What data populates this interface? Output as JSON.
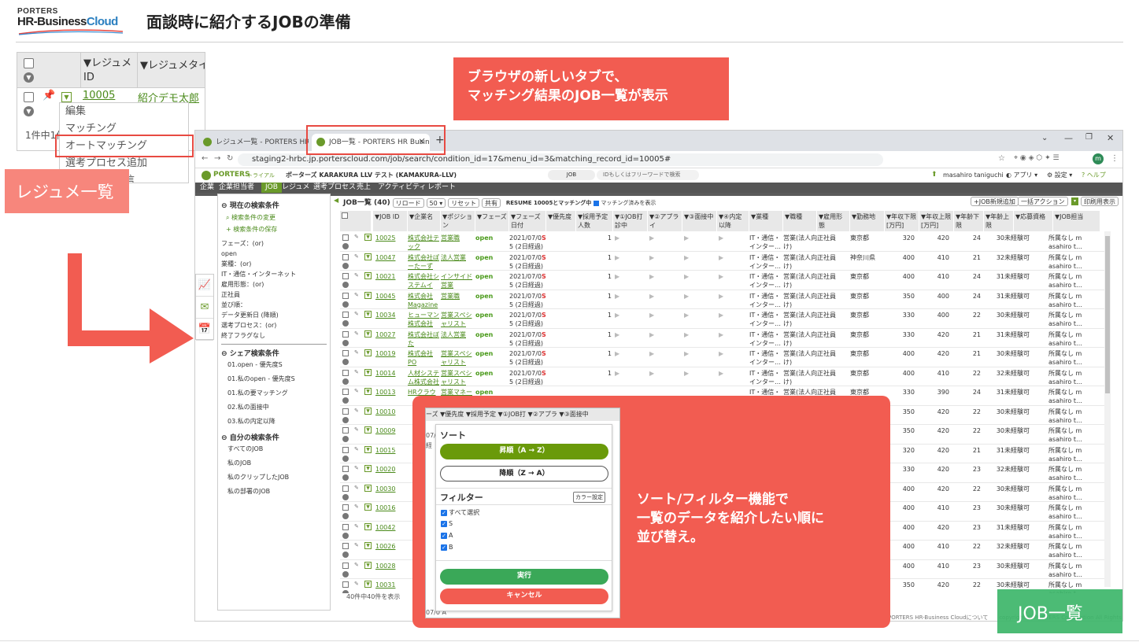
{
  "logo": {
    "line1": "PORTERS",
    "line2a": "HR-Business",
    "line2b": "Cloud"
  },
  "page_title": "面談時に紹介するJOBの準備",
  "callouts": {
    "top": [
      "ブラウザの新しいタブで、",
      "マッチング結果のJOB一覧が表示"
    ],
    "bottom": [
      "ソート/フィルター機能で",
      "一覧のデータを紹介したい順に",
      "並び替え。"
    ]
  },
  "tags": {
    "resume": "レジュメ一覧",
    "job": "JOB一覧"
  },
  "resume_table": {
    "col1": "▼レジュメ ID",
    "col2": "▼レジュメタイ",
    "id": "10005",
    "name": "紹介デモ太郎",
    "count": "1件中1件",
    "menu": [
      "編集",
      "マッチング",
      "オートマッチング",
      "選考プロセス追加",
      "JOBメール送信"
    ]
  },
  "browser": {
    "tabs": [
      {
        "label": "レジュメ一覧 - PORTERS HR Business"
      },
      {
        "label": "JOB一覧 - PORTERS HR Business"
      }
    ],
    "url": "staging2-hrbc.jp.porterscloud.com/job/search/condition_id=17&menu_id=3&matching_record_id=10005#",
    "app": {
      "logo": "PORTERS",
      "trial": "トライアル",
      "company": "ポーターズ KARAKURA LLV テスト (KAMAKURA-LLV)",
      "search_scope": "JOB",
      "search_placeholder": "IDもしくはフリーワードで検索",
      "user": "masahiro taniguchi",
      "app_menu": "アプリ",
      "settings": "設定",
      "help": "ヘルプ"
    },
    "nav": [
      "企業",
      "企業担当者",
      "JOB",
      "レジュメ",
      "選考プロセス",
      "売上",
      "アクティビティ",
      "レポート"
    ],
    "left": {
      "current": "現在の検索条件",
      "change": "検索条件の変更",
      "save": "検索条件の保存",
      "conditions": [
        "フェーズ：(or)",
        "open",
        "業種：(or)",
        "IT・通信・インターネット",
        "雇用形態：(or)",
        "正社員",
        "並び順：",
        "データ更新日 (降順)",
        "選考プロセス：(or)",
        "終了フラグなし"
      ],
      "shared": "シェア検索条件",
      "shared_items": [
        "01.open - 優先度S",
        "01.私のopen - 優先度S",
        "01.私の要マッチング",
        "02.私の面接中",
        "03.私の内定以降"
      ],
      "mine": "自分の検索条件",
      "mine_items": [
        "すべてのJOB",
        "私のJOB",
        "私のクリップしたJOB",
        "私の部署のJOB"
      ]
    },
    "list": {
      "title": "JOB一覧 (40)",
      "reload": "リロード",
      "per_page": "50",
      "reset": "リセット",
      "share": "共有",
      "matching": "RESUME 10005とマッチング中",
      "show_matched": "マッチング済みを表示",
      "new": "+JOB新規追加",
      "bulk": "一括アクション",
      "print": "印刷用表示",
      "footer": "40件中40件を表示"
    },
    "columns": [
      "▼JOB ID",
      "▼企業名",
      "▼ポジション",
      "▼フェーズ",
      "▼フェーズ日付",
      "▼優先度",
      "▼採用予定人数",
      "▼①JOB打診中",
      "▼②アプライ",
      "▼③面接中",
      "▼④内定以降",
      "▼業種",
      "▼職種",
      "▼雇用形態",
      "▼勤務地",
      "▼年収下限[万円]",
      "▼年収上限[万円]",
      "▼年齢下限",
      "▼年齢上限",
      "▼応募資格",
      "▼JOB担当"
    ],
    "rows": [
      {
        "id": "10025",
        "company": [
          "株式会社テ",
          "ック"
        ],
        "position": [
          "営業職",
          ""
        ],
        "phase": "open",
        "date": [
          "2021/07/0",
          "5 (2日経過)"
        ],
        "pri": "S",
        "hires": "1",
        "ind": [
          "IT・通信・",
          "インター…"
        ],
        "job": [
          "営業(法人向",
          "け)"
        ],
        "emp": "正社員",
        "loc": "東京都",
        "smin": "320",
        "smax": "420",
        "amin": "24",
        "amax": "30",
        "qual": "未経験可",
        "owner": [
          "所属なし m",
          "asahiro t…"
        ]
      },
      {
        "id": "10047",
        "company": [
          "株式会社ぽ",
          "ーたーず"
        ],
        "position": [
          "法人営業",
          ""
        ],
        "phase": "open",
        "date": [
          "2021/07/0",
          "5 (2日経過)"
        ],
        "pri": "S",
        "hires": "1",
        "ind": [
          "IT・通信・",
          "インター…"
        ],
        "job": [
          "営業(法人向",
          "け)"
        ],
        "emp": "正社員",
        "loc": "神奈川県",
        "smin": "400",
        "smax": "410",
        "amin": "21",
        "amax": "32",
        "qual": "未経験可",
        "owner": [
          "所属なし m",
          "asahiro t…"
        ]
      },
      {
        "id": "10021",
        "company": [
          "株式会社シ",
          "ステムイ"
        ],
        "position": [
          "インサイド",
          "営業"
        ],
        "phase": "open",
        "date": [
          "2021/07/0",
          "5 (2日経過)"
        ],
        "pri": "S",
        "hires": "1",
        "ind": [
          "IT・通信・",
          "インター…"
        ],
        "job": [
          "営業(法人向",
          "け)"
        ],
        "emp": "正社員",
        "loc": "東京都",
        "smin": "400",
        "smax": "410",
        "amin": "24",
        "amax": "31",
        "qual": "未経験可",
        "owner": [
          "所属なし m",
          "asahiro t…"
        ]
      },
      {
        "id": "10045",
        "company": [
          "株式会社",
          "Magazine"
        ],
        "position": [
          "営業職",
          ""
        ],
        "phase": "open",
        "date": [
          "2021/07/0",
          "5 (2日経過)"
        ],
        "pri": "S",
        "hires": "1",
        "ind": [
          "IT・通信・",
          "インター…"
        ],
        "job": [
          "営業(法人向",
          "け)"
        ],
        "emp": "正社員",
        "loc": "東京都",
        "smin": "350",
        "smax": "400",
        "amin": "24",
        "amax": "31",
        "qual": "未経験可",
        "owner": [
          "所属なし m",
          "asahiro t…"
        ]
      },
      {
        "id": "10034",
        "company": [
          "ヒューマン",
          "株式会社"
        ],
        "position": [
          "営業スペシ",
          "ャリスト"
        ],
        "phase": "open",
        "date": [
          "2021/07/0",
          "5 (2日経過)"
        ],
        "pri": "S",
        "hires": "1",
        "ind": [
          "IT・通信・",
          "インター…"
        ],
        "job": [
          "営業(法人向",
          "け)"
        ],
        "emp": "正社員",
        "loc": "東京都",
        "smin": "330",
        "smax": "400",
        "amin": "22",
        "amax": "30",
        "qual": "未経験可",
        "owner": [
          "所属なし m",
          "asahiro t…"
        ]
      },
      {
        "id": "10027",
        "company": [
          "株式会社ぼ",
          "た"
        ],
        "position": [
          "法人営業",
          ""
        ],
        "phase": "open",
        "date": [
          "2021/07/0",
          "5 (2日経過)"
        ],
        "pri": "S",
        "hires": "1",
        "ind": [
          "IT・通信・",
          "インター…"
        ],
        "job": [
          "営業(法人向",
          "け)"
        ],
        "emp": "正社員",
        "loc": "東京都",
        "smin": "330",
        "smax": "420",
        "amin": "21",
        "amax": "31",
        "qual": "未経験可",
        "owner": [
          "所属なし m",
          "asahiro t…"
        ]
      },
      {
        "id": "10019",
        "company": [
          "株式会社",
          "PO"
        ],
        "position": [
          "営業スペシ",
          "ャリスト"
        ],
        "phase": "open",
        "date": [
          "2021/07/0",
          "5 (2日経過)"
        ],
        "pri": "S",
        "hires": "1",
        "ind": [
          "IT・通信・",
          "インター…"
        ],
        "job": [
          "営業(法人向",
          "け)"
        ],
        "emp": "正社員",
        "loc": "東京都",
        "smin": "400",
        "smax": "420",
        "amin": "21",
        "amax": "30",
        "qual": "未経験可",
        "owner": [
          "所属なし m",
          "asahiro t…"
        ]
      },
      {
        "id": "10014",
        "company": [
          "人材システ",
          "ム株式会社"
        ],
        "position": [
          "営業スペシ",
          "ャリスト"
        ],
        "phase": "open",
        "date": [
          "2021/07/0",
          "5 (2日経過)"
        ],
        "pri": "S",
        "hires": "1",
        "ind": [
          "IT・通信・",
          "インター…"
        ],
        "job": [
          "営業(法人向",
          "け)"
        ],
        "emp": "正社員",
        "loc": "東京都",
        "smin": "400",
        "smax": "410",
        "amin": "22",
        "amax": "32",
        "qual": "未経験可",
        "owner": [
          "所属なし m",
          "asahiro t…"
        ]
      },
      {
        "id": "10013",
        "company": [
          "HRクラウ",
          ""
        ],
        "position": [
          "営業マネー",
          ""
        ],
        "phase": "open",
        "date": [
          "",
          ""
        ],
        "pri": "",
        "hires": "",
        "ind": [
          "IT・通信・",
          "インター…"
        ],
        "job": [
          "営業(法人向",
          "け)"
        ],
        "emp": "正社員",
        "loc": "東京都",
        "smin": "330",
        "smax": "390",
        "amin": "24",
        "amax": "31",
        "qual": "未経験可",
        "owner": [
          "所属なし m",
          "asahiro t…"
        ]
      },
      {
        "id": "10010",
        "smin": "350",
        "smax": "420",
        "amin": "22",
        "amax": "30",
        "qual": "未経験可",
        "owner": [
          "所属なし m",
          "asahiro t…"
        ]
      },
      {
        "id": "10009",
        "smin": "350",
        "smax": "420",
        "amin": "22",
        "amax": "30",
        "qual": "未経験可",
        "owner": [
          "所属なし m",
          "asahiro t…"
        ]
      },
      {
        "id": "10015",
        "smin": "320",
        "smax": "420",
        "amin": "21",
        "amax": "31",
        "qual": "未経験可",
        "owner": [
          "所属なし m",
          "asahiro t…"
        ]
      },
      {
        "id": "10020",
        "smin": "330",
        "smax": "420",
        "amin": "23",
        "amax": "32",
        "qual": "未経験可",
        "owner": [
          "所属なし m",
          "asahiro t…"
        ]
      },
      {
        "id": "10030",
        "smin": "400",
        "smax": "420",
        "amin": "22",
        "amax": "30",
        "qual": "未経験可",
        "owner": [
          "所属なし m",
          "asahiro t…"
        ]
      },
      {
        "id": "10016",
        "smin": "400",
        "smax": "410",
        "amin": "23",
        "amax": "30",
        "qual": "未経験可",
        "owner": [
          "所属なし m",
          "asahiro t…"
        ]
      },
      {
        "id": "10042",
        "smin": "400",
        "smax": "420",
        "amin": "23",
        "amax": "31",
        "qual": "未経験可",
        "owner": [
          "所属なし m",
          "asahiro t…"
        ]
      },
      {
        "id": "10026",
        "smin": "400",
        "smax": "410",
        "amin": "22",
        "amax": "32",
        "qual": "未経験可",
        "owner": [
          "所属なし m",
          "asahiro t…"
        ]
      },
      {
        "id": "10028",
        "smin": "400",
        "smax": "410",
        "amin": "23",
        "amax": "30",
        "qual": "未経験可",
        "owner": [
          "所属なし m",
          "asahiro t…"
        ]
      },
      {
        "id": "10031",
        "smin": "350",
        "smax": "420",
        "amin": "22",
        "amax": "30",
        "qual": "未経験可",
        "owner": [
          "所属なし m",
          "asahiro t…"
        ]
      }
    ],
    "copyright": "PORTERS HR-Business Cloudについて　　copyright © PORTERS Corporation All Rights Reserved."
  },
  "dropdown": {
    "header": "ーズ ▼優先度 ▼採用予定 ▼①JOB打 ▼②アプラ ▼③面接中",
    "sort_title": "ソート",
    "asc": "昇順（A → Z）",
    "desc": "降順（Z → A）",
    "filter_title": "フィルター",
    "color_setting": "カラー設定",
    "options": [
      "すべて選択",
      "S",
      "A",
      "B"
    ],
    "run": "実行",
    "cancel": "キャンセル",
    "behind_rows": [
      "07/0",
      "経"
    ],
    "behind_bottom": "07/0 A"
  },
  "colors": {
    "accent_red": "#f25c51",
    "green": "#3db66a",
    "brand_green": "#6a9a2a"
  }
}
